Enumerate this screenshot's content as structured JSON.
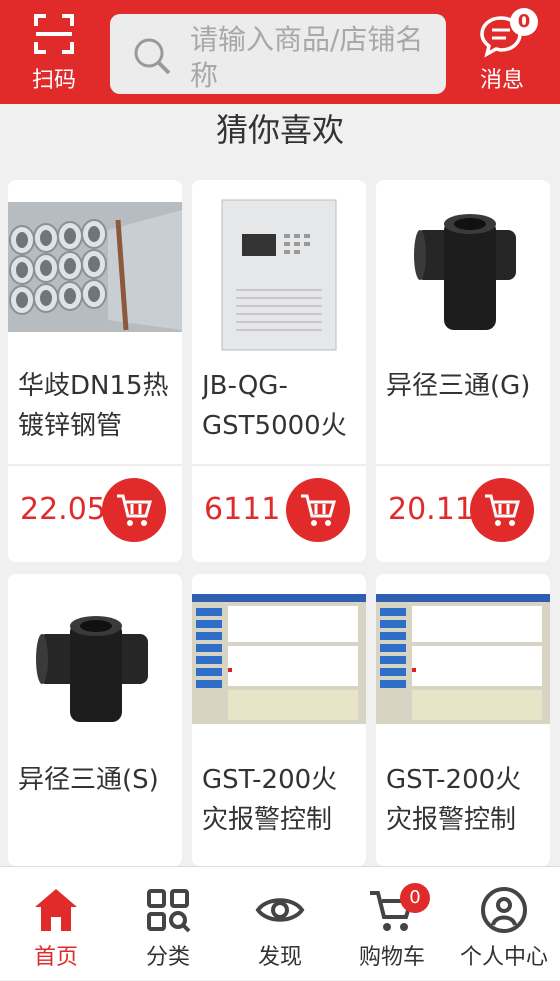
{
  "colors": {
    "accent": "#e12b2b"
  },
  "header": {
    "scan_label": "扫码",
    "search_placeholder": "请输入商品/店铺名称",
    "message_label": "消息",
    "message_count": "0"
  },
  "section": {
    "title": "猜你喜欢"
  },
  "products": [
    {
      "name": "华歧DN15热镀锌钢管",
      "price": "22.05",
      "image": "galvanized-pipes"
    },
    {
      "name": "JB-QG-GST5000火",
      "price": "6111",
      "image": "fire-control-panel"
    },
    {
      "name": "异径三通(G)",
      "price": "20.11",
      "image": "black-tee-fitting"
    },
    {
      "name": "异径三通(S)",
      "price": "",
      "image": "black-tee-fitting"
    },
    {
      "name": "GST-200火灾报警控制",
      "price": "",
      "image": "software-screenshot"
    },
    {
      "name": "GST-200火灾报警控制",
      "price": "",
      "image": "software-screenshot"
    }
  ],
  "tabbar": {
    "items": [
      {
        "label": "首页",
        "icon": "home-icon"
      },
      {
        "label": "分类",
        "icon": "category-icon"
      },
      {
        "label": "发现",
        "icon": "eye-icon"
      },
      {
        "label": "购物车",
        "icon": "cart-icon"
      },
      {
        "label": "个人中心",
        "icon": "user-icon"
      }
    ],
    "cart_count": "0"
  }
}
